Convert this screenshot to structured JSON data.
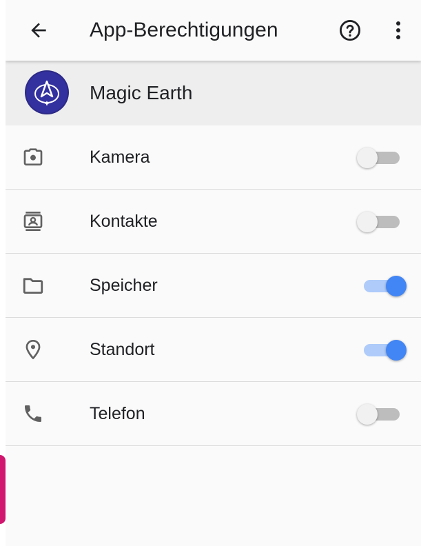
{
  "appbar": {
    "title": "App-Berechtigungen",
    "back_icon": "arrow-back-icon",
    "help_icon": "help-circle-icon",
    "more_icon": "more-vert-icon"
  },
  "app": {
    "name": "Magic Earth",
    "icon": "magic-earth-app-icon"
  },
  "permissions": [
    {
      "label": "Kamera",
      "icon": "camera-icon",
      "enabled": false
    },
    {
      "label": "Kontakte",
      "icon": "contacts-icon",
      "enabled": false
    },
    {
      "label": "Speicher",
      "icon": "folder-icon",
      "enabled": true
    },
    {
      "label": "Standort",
      "icon": "location-pin-icon",
      "enabled": true
    },
    {
      "label": "Telefon",
      "icon": "phone-icon",
      "enabled": false
    }
  ],
  "colors": {
    "switch_on_thumb": "#4285f4",
    "switch_on_track": "#aecbfa",
    "switch_off_thumb": "#f1f1f1",
    "switch_off_track": "#bdbdbd",
    "app_icon_bg": "#2c2a86"
  }
}
